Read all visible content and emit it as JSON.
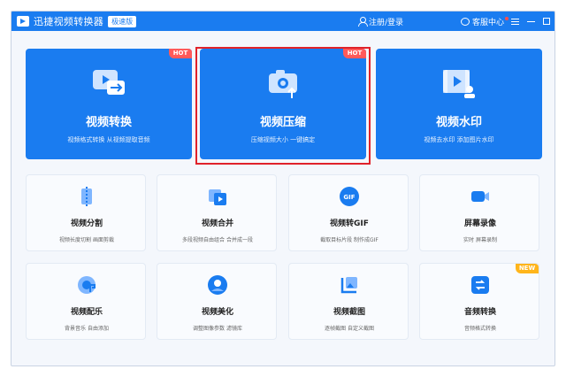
{
  "titlebar": {
    "app_title": "迅捷视频转换器",
    "edition_badge": "极速版",
    "login_label": "注册/登录",
    "support_label": "客服中心"
  },
  "featured": [
    {
      "title": "视频转换",
      "subtitle": "视频格式转换 从视频提取音频",
      "badge": "HOT",
      "icon": "video-convert-icon"
    },
    {
      "title": "视频压缩",
      "subtitle": "压缩视频大小 一键搞定",
      "badge": "HOT",
      "icon": "camera-compress-icon"
    },
    {
      "title": "视频水印",
      "subtitle": "视频去水印 添加图片水印",
      "badge": "",
      "icon": "film-watermark-icon"
    }
  ],
  "tools": [
    {
      "title": "视频分割",
      "subtitle": "视频长度切割 画面剪裁",
      "icon": "split-icon"
    },
    {
      "title": "视频合并",
      "subtitle": "多段视频自由组合 合并成一段",
      "icon": "merge-icon"
    },
    {
      "title": "视频转GIF",
      "subtitle": "截取目标片段 制作成GIF",
      "icon": "gif-icon"
    },
    {
      "title": "屏幕录像",
      "subtitle": "实时 屏幕录制",
      "icon": "screen-record-icon"
    },
    {
      "title": "视频配乐",
      "subtitle": "背景音乐 自由添加",
      "icon": "music-icon"
    },
    {
      "title": "视频美化",
      "subtitle": "调整图像参数 滤镜库",
      "icon": "beautify-icon"
    },
    {
      "title": "视频截图",
      "subtitle": "逐帧截图 自定义截图",
      "icon": "screenshot-icon"
    },
    {
      "title": "音频转换",
      "subtitle": "音频格式转换",
      "icon": "audio-convert-icon",
      "badge": "NEW"
    }
  ],
  "colors": {
    "primary": "#1a7cf0",
    "hot": "#ff5a5a",
    "new": "#ffb51b",
    "highlight": "#e0222a"
  }
}
